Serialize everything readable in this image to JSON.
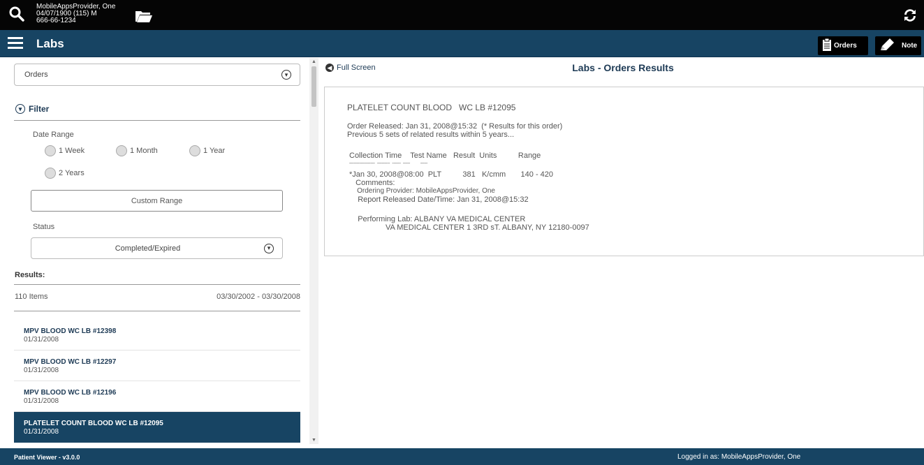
{
  "patient": {
    "name": "MobileAppsProvider, One",
    "dob_line": "04/07/1900 (115) M",
    "ssn": "666-66-1234"
  },
  "header": {
    "title": "Labs",
    "orders_label": "Orders",
    "note_label": "Note"
  },
  "left": {
    "orders_select": "Orders",
    "filter_label": "Filter",
    "date_range_label": "Date Range",
    "date_options": [
      "1 Week",
      "1 Month",
      "1 Year",
      "2 Years"
    ],
    "custom_range_label": "Custom Range",
    "status_label": "Status",
    "status_select": "Completed/Expired",
    "results_label": "Results:",
    "item_count": "110 Items",
    "date_range_value": "03/30/2002 - 03/30/2008",
    "items": [
      {
        "name": "MPV BLOOD WC LB #12398",
        "date": "01/31/2008"
      },
      {
        "name": "MPV BLOOD WC LB #12297",
        "date": "01/31/2008"
      },
      {
        "name": "MPV BLOOD WC LB #12196",
        "date": "01/31/2008"
      },
      {
        "name": "PLATELET COUNT BLOOD WC LB #12095",
        "date": "01/31/2008",
        "selected": true
      }
    ]
  },
  "right": {
    "full_screen_label": "Full Screen",
    "title": "Labs - Orders Results",
    "report_lines": [
      "PLATELET COUNT BLOOD   WC LB #12095",
      "Order Released: Jan 31, 2008@15:32  (* Results for this order)",
      "Previous 5 sets of related results within 5 years...",
      "Collection Time    Test Name   Result  Units          Range",
      "------------------  ---------  ------  -----         -----",
      "*Jan 30, 2008@08:00  PLT          381   K/cmm       140 - 420",
      "   Comments:",
      "    Ordering Provider: MobileAppsProvider, One",
      "    Report Released Date/Time: Jan 31, 2008@15:32",
      "    Performing Lab: ALBANY VA MEDICAL CENTER",
      "                 VA MEDICAL CENTER 1 3RD sT. ALBANY, NY 12180-0097"
    ]
  },
  "footer": {
    "version": "Patient Viewer - v3.0.0",
    "logged_in": "Logged in as: MobileAppsProvider, One"
  },
  "icons": {
    "search": "search-icon",
    "folder": "folder-icon",
    "sync": "sync-icon",
    "menu": "hamburger-menu-icon",
    "orders": "clipboard-icon",
    "note": "pencil-icon"
  },
  "colors": {
    "header_bg": "#174463",
    "topbar_bg": "#050505",
    "accent_text": "#1d3a55"
  }
}
